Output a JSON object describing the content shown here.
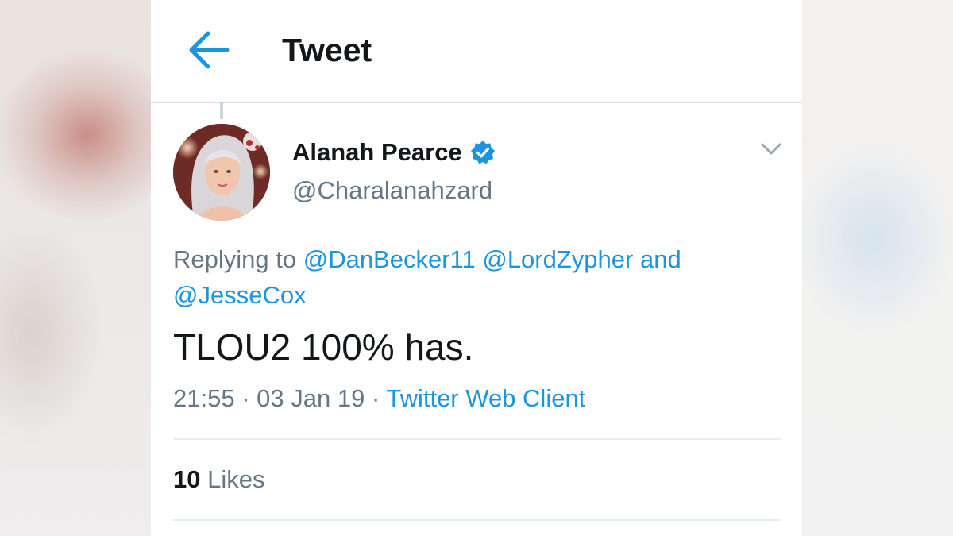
{
  "header": {
    "title": "Tweet"
  },
  "tweet": {
    "author_name": "Alanah Pearce",
    "author_handle": "@Charalanahzard",
    "replying_prefix": "Replying to",
    "replying_to": [
      "@DanBecker11",
      "@LordZypher",
      "@JesseCox"
    ],
    "replying_and": "and",
    "text": "TLOU2 100% has.",
    "time": "21:55",
    "date": "03 Jan 19",
    "separator": "·",
    "source": "Twitter Web Client",
    "likes_count": "10",
    "likes_label": "Likes"
  },
  "icons": {
    "back": "arrow-left-icon",
    "verified": "verified-badge-icon",
    "menu": "chevron-down-icon"
  },
  "colors": {
    "accent": "#1b95e0",
    "text_primary": "#14171a",
    "text_secondary": "#657786"
  }
}
